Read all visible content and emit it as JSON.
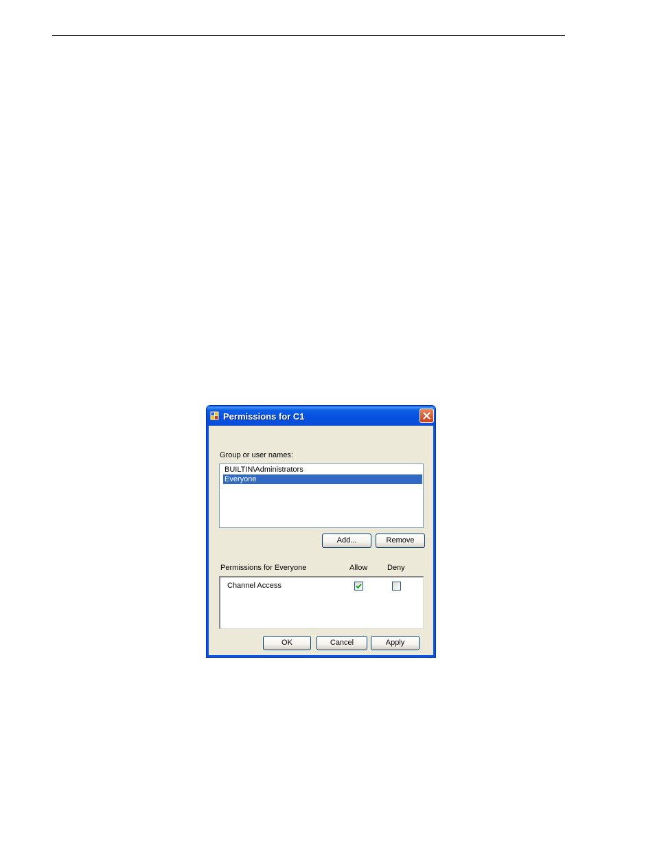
{
  "dialog": {
    "title": "Permissions for C1",
    "group_label": "Group or user names:",
    "users": [
      {
        "name": "BUILTIN\\Administrators",
        "selected": false
      },
      {
        "name": "Everyone",
        "selected": true
      }
    ],
    "add_label": "Add...",
    "remove_label": "Remove",
    "permissions_label": "Permissions for Everyone",
    "allow_header": "Allow",
    "deny_header": "Deny",
    "permissions": [
      {
        "name": "Channel Access",
        "allow": true,
        "deny": false
      }
    ],
    "ok_label": "OK",
    "cancel_label": "Cancel",
    "apply_label": "Apply"
  },
  "colors": {
    "titlebar": "#0a54e3",
    "selection": "#316ac5",
    "dialog_face": "#ece9d8",
    "close_button": "#c8401c",
    "checkmark": "#21a121"
  },
  "icons": {
    "app": "permissions-app-icon",
    "close": "close-icon",
    "check": "checkmark-icon"
  }
}
